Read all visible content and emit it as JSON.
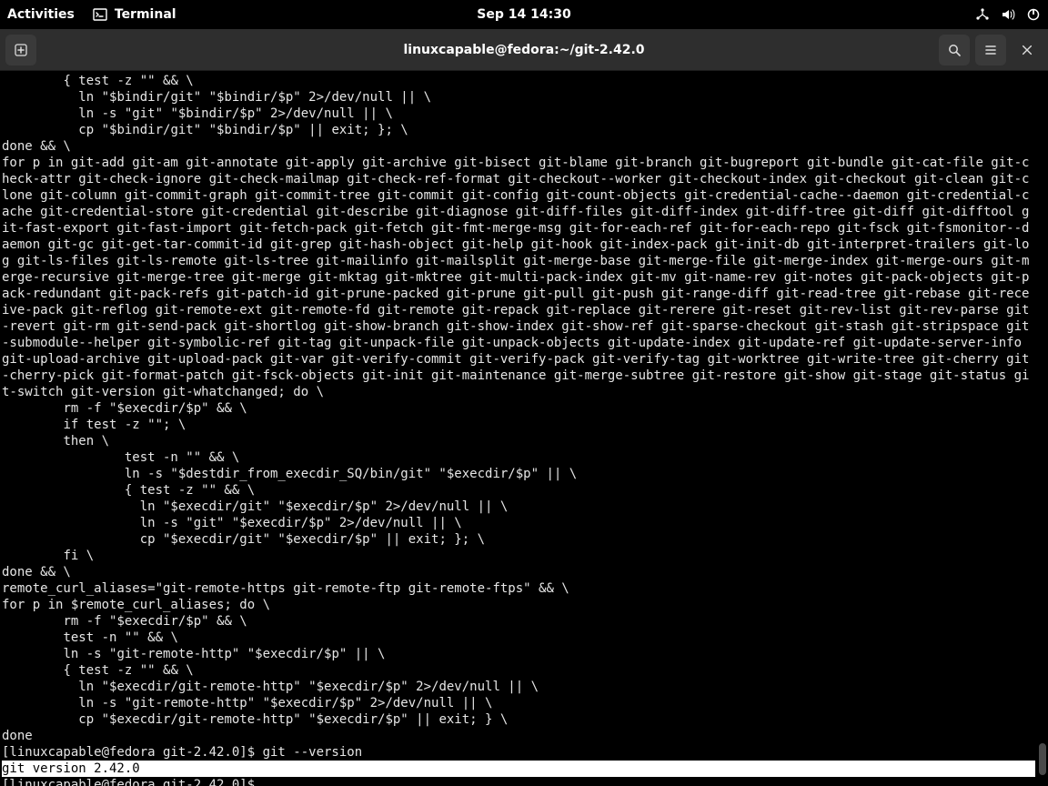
{
  "topbar": {
    "activities": "Activities",
    "app_label": "Terminal",
    "datetime": "Sep 14  14:30"
  },
  "titlebar": {
    "title": "linuxcapable@fedora:~/git-2.42.0"
  },
  "terminal": {
    "lines": [
      "        { test -z \"\" && \\",
      "          ln \"$bindir/git\" \"$bindir/$p\" 2>/dev/null || \\",
      "          ln -s \"git\" \"$bindir/$p\" 2>/dev/null || \\",
      "          cp \"$bindir/git\" \"$bindir/$p\" || exit; }; \\",
      "done && \\",
      "for p in git-add git-am git-annotate git-apply git-archive git-bisect git-blame git-branch git-bugreport git-bundle git-cat-file git-check-attr git-check-ignore git-check-mailmap git-check-ref-format git-checkout--worker git-checkout-index git-checkout git-clean git-clone git-column git-commit-graph git-commit-tree git-commit git-config git-count-objects git-credential-cache--daemon git-credential-cache git-credential-store git-credential git-describe git-diagnose git-diff-files git-diff-index git-diff-tree git-diff git-difftool git-fast-export git-fast-import git-fetch-pack git-fetch git-fmt-merge-msg git-for-each-ref git-for-each-repo git-fsck git-fsmonitor--daemon git-gc git-get-tar-commit-id git-grep git-hash-object git-help git-hook git-index-pack git-init-db git-interpret-trailers git-log git-ls-files git-ls-remote git-ls-tree git-mailinfo git-mailsplit git-merge-base git-merge-file git-merge-index git-merge-ours git-merge-recursive git-merge-tree git-merge git-mktag git-mktree git-multi-pack-index git-mv git-name-rev git-notes git-pack-objects git-pack-redundant git-pack-refs git-patch-id git-prune-packed git-prune git-pull git-push git-range-diff git-read-tree git-rebase git-receive-pack git-reflog git-remote-ext git-remote-fd git-remote git-repack git-replace git-rerere git-reset git-rev-list git-rev-parse git-revert git-rm git-send-pack git-shortlog git-show-branch git-show-index git-show-ref git-sparse-checkout git-stash git-stripspace git-submodule--helper git-symbolic-ref git-tag git-unpack-file git-unpack-objects git-update-index git-update-ref git-update-server-info git-upload-archive git-upload-pack git-var git-verify-commit git-verify-pack git-verify-tag git-worktree git-write-tree git-cherry git-cherry-pick git-format-patch git-fsck-objects git-init git-maintenance git-merge-subtree git-restore git-show git-stage git-status git-switch git-version git-whatchanged; do \\",
      "        rm -f \"$execdir/$p\" && \\",
      "        if test -z \"\"; \\",
      "        then \\",
      "                test -n \"\" && \\",
      "                ln -s \"$destdir_from_execdir_SQ/bin/git\" \"$execdir/$p\" || \\",
      "                { test -z \"\" && \\",
      "                  ln \"$execdir/git\" \"$execdir/$p\" 2>/dev/null || \\",
      "                  ln -s \"git\" \"$execdir/$p\" 2>/dev/null || \\",
      "                  cp \"$execdir/git\" \"$execdir/$p\" || exit; }; \\",
      "        fi \\",
      "done && \\",
      "remote_curl_aliases=\"git-remote-https git-remote-ftp git-remote-ftps\" && \\",
      "for p in $remote_curl_aliases; do \\",
      "        rm -f \"$execdir/$p\" && \\",
      "        test -n \"\" && \\",
      "        ln -s \"git-remote-http\" \"$execdir/$p\" || \\",
      "        { test -z \"\" && \\",
      "          ln \"$execdir/git-remote-http\" \"$execdir/$p\" 2>/dev/null || \\",
      "          ln -s \"git-remote-http\" \"$execdir/$p\" 2>/dev/null || \\",
      "          cp \"$execdir/git-remote-http\" \"$execdir/$p\" || exit; } \\",
      "done"
    ],
    "prompt1_prefix": "[linuxcapable@fedora git-2.42.0]$ ",
    "prompt1_cmd": "git --version",
    "highlight_line": "git version 2.42.0",
    "prompt2": "[linuxcapable@fedora git-2.42.0]$ "
  },
  "scrollbar": {
    "thumb_top_pct": 94,
    "thumb_height_pct": 4.5
  }
}
